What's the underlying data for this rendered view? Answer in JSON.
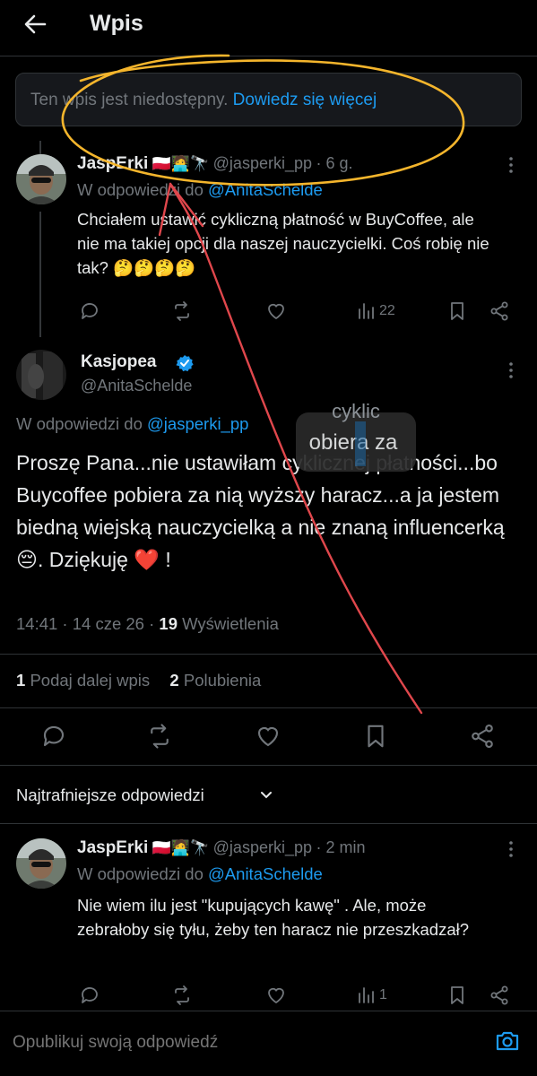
{
  "header": {
    "title": "Wpis"
  },
  "notice": {
    "text": "Ten wpis jest niedostępny.",
    "link": "Dowiedz się więcej"
  },
  "post1": {
    "name": "JaspErki",
    "emoji": "🇵🇱🧑‍💻🔭",
    "handle": "@jasperki_pp",
    "time": "· 6 g.",
    "reply_prefix": "W odpowiedzi do",
    "reply_to": "@AnitaSchelde",
    "text": "Chciałem ustawić cykliczną płatność w BuyCoffee, ale nie ma takiej opcji dla naszej nauczycielki. Coś robię nie tak? 🤔🤔🤔🤔",
    "views": "22"
  },
  "main_post": {
    "name": "Kasjopea",
    "handle": "@AnitaSchelde",
    "reply_prefix": "W odpowiedzi do",
    "reply_to": "@jasperki_pp",
    "text": "Proszę Pana...nie ustawiłam cyklicznej płatności...bo Buycoffee pobiera za nią wyższy haracz...a ja jestem biedną wiejską nauczycielką a nie znaną influencerką 😔. Dziękuję ❤️ !",
    "timestamp": "14:41 · 14 cze 26 ·",
    "views_count": "19",
    "views_label": "Wyświetlenia",
    "reposts_count": "1",
    "reposts_label": "Podaj dalej wpis",
    "likes_count": "2",
    "likes_label": "Polubienia"
  },
  "overlay": {
    "line1": "cyklic",
    "line2": "obiera za"
  },
  "sort": {
    "label": "Najtrafniejsze odpowiedzi"
  },
  "post2": {
    "name": "JaspErki",
    "emoji": "🇵🇱🧑‍💻🔭",
    "handle": "@jasperki_pp",
    "time": "· 2 min",
    "reply_prefix": "W odpowiedzi do",
    "reply_to": "@AnitaSchelde",
    "text": "Nie wiem ilu jest \"kupujących kawę\" . Ale, może zebrałoby się tyłu, żeby ten haracz nie przeszkadzał?",
    "views": "1"
  },
  "reply_box": {
    "placeholder": "Opublikuj swoją odpowiedź"
  },
  "colors": {
    "accent": "#1d9bf0",
    "annotation_yellow": "#f4b52c",
    "annotation_red": "#e0474c"
  }
}
